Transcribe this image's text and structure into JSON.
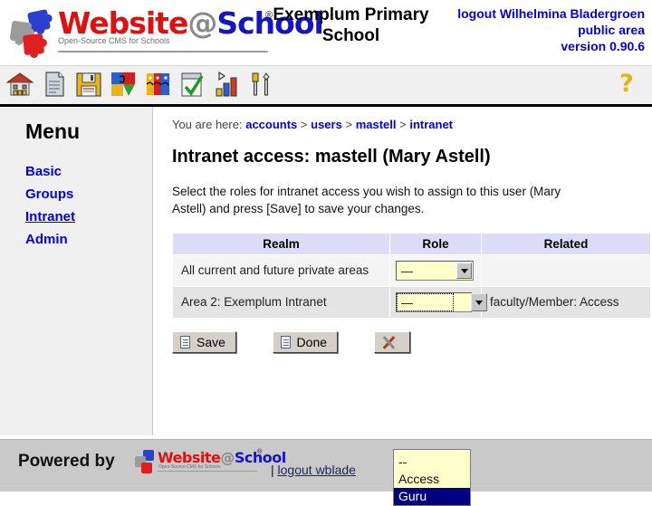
{
  "header": {
    "logo": {
      "word_part1": "Website",
      "word_at": "@",
      "word_part2": "School",
      "tagline": "Open-Source CMS for Schools",
      "registered_mark": "®"
    },
    "school_name": "Exemplum Primary School",
    "logout_user": "logout Wilhelmina Bladergroen",
    "area": "public area",
    "version": "version 0.90.6"
  },
  "toolbar": {
    "icons": [
      {
        "name": "home-icon",
        "label": "Home"
      },
      {
        "name": "page-icon",
        "label": "Pages"
      },
      {
        "name": "save-disk-icon",
        "label": "File manager"
      },
      {
        "name": "modules-puzzle-icon",
        "label": "Modules"
      },
      {
        "name": "users-faces-icon",
        "label": "Users"
      },
      {
        "name": "checklist-icon",
        "label": "Tasks"
      },
      {
        "name": "statistics-chart-icon",
        "label": "Statistics"
      },
      {
        "name": "tools-wrench-icon",
        "label": "Tools"
      }
    ],
    "help_icon": "?"
  },
  "sidebar": {
    "title": "Menu",
    "items": [
      {
        "label": "Basic",
        "active": false
      },
      {
        "label": "Groups",
        "active": false
      },
      {
        "label": "Intranet",
        "active": true
      },
      {
        "label": "Admin",
        "active": false
      }
    ]
  },
  "content": {
    "breadcrumb_prefix": "You are here:",
    "breadcrumb": [
      "accounts",
      "users",
      "mastell",
      "intranet"
    ],
    "breadcrumb_separator": ">",
    "page_title": "Intranet access: mastell (Mary Astell)",
    "intro": "Select the roles for intranet access you wish to assign to this user (Mary Astell) and press [Save] to save your changes.",
    "table": {
      "headers": [
        "Realm",
        "Role",
        "Related"
      ],
      "rows": [
        {
          "realm": "All current and future private areas",
          "role_value": "—",
          "related": ""
        },
        {
          "realm": "Area 2: Exemplum Intranet",
          "role_value": "—",
          "related": "faculty/Member: Access"
        }
      ]
    },
    "dropdown": {
      "open": true,
      "options": [
        "--",
        "Access",
        "Guru"
      ],
      "highlighted": "Guru"
    },
    "buttons": {
      "save": "Save",
      "done": "Done",
      "cancel": ""
    }
  },
  "footer": {
    "powered_by": "Powered by",
    "logo_word1": "Website",
    "logo_at": "@",
    "logo_word2": "School",
    "logo_tagline": "Open-Source CMS for Schools",
    "logo_reg": "®",
    "separator": "|",
    "logout_link": "logout wblade"
  },
  "colors": {
    "link_blue": "#0000ee",
    "header_blue": "#0000ee",
    "table_header_bg": "#dcdcf8",
    "row_a_bg": "#f4f4f4",
    "row_b_bg": "#e4e4e4",
    "select_bg": "#ffffcc",
    "option_highlight_bg": "#000080",
    "help_icon": "#e8b515",
    "footer_bg": "#c9c9c9"
  }
}
